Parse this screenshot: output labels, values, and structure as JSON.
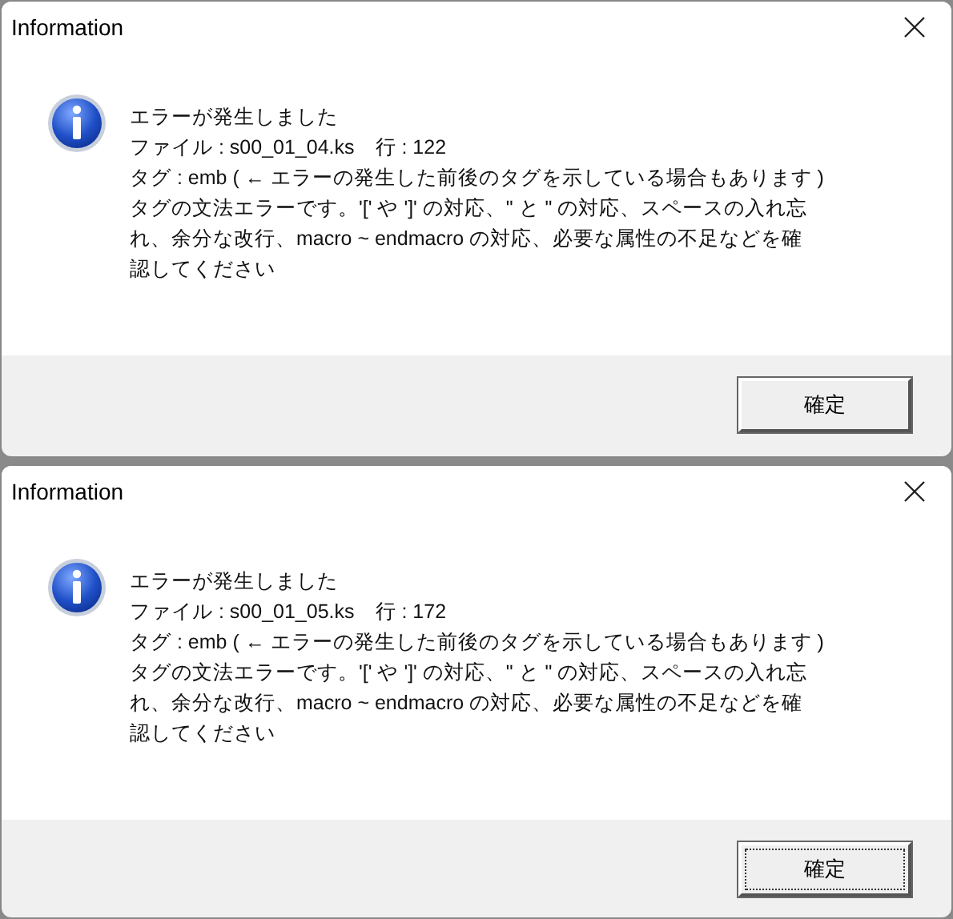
{
  "dialogs": [
    {
      "title": "Information",
      "message_lines": [
        "エラーが発生しました",
        "ファイル : s00_01_04.ks　行 : 122",
        "タグ : emb ( ← エラーの発生した前後のタグを示している場合もあります )",
        "タグの文法エラーです。'[' や ']' の対応、\" と \" の対応、スペースの入れ忘",
        "れ、余分な改行、macro ~ endmacro の対応、必要な属性の不足などを確",
        "認してください"
      ],
      "button": {
        "label": "確定",
        "focused": false
      }
    },
    {
      "title": "Information",
      "message_lines": [
        "エラーが発生しました",
        "ファイル : s00_01_05.ks　行 : 172",
        "タグ : emb ( ← エラーの発生した前後のタグを示している場合もあります )",
        "タグの文法エラーです。'[' や ']' の対応、\" と \" の対応、スペースの入れ忘",
        "れ、余分な改行、macro ~ endmacro の対応、必要な属性の不足などを確",
        "認してください"
      ],
      "button": {
        "label": "確定",
        "focused": true
      }
    }
  ]
}
